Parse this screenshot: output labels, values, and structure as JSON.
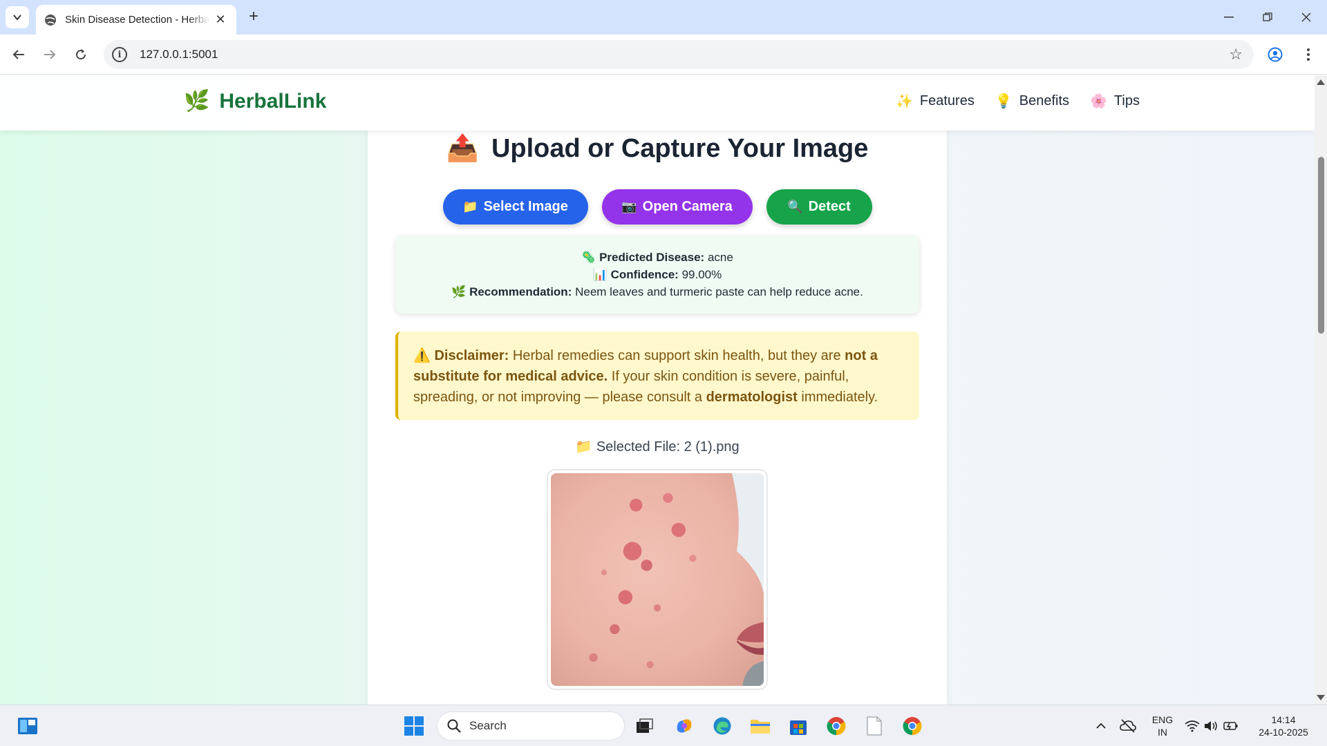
{
  "browser": {
    "tab_title": "Skin Disease Detection - HerbalLink",
    "url": "127.0.0.1:5001"
  },
  "site": {
    "logo": "HerbalLink",
    "nav": [
      {
        "icon": "✨",
        "label": "Features"
      },
      {
        "icon": "💡",
        "label": "Benefits"
      },
      {
        "icon": "🌸",
        "label": "Tips"
      }
    ]
  },
  "upload": {
    "title_icon": "📤",
    "title": "Upload or Capture Your Image",
    "buttons": [
      {
        "icon": "📁",
        "label": "Select Image",
        "color": "#2563eb"
      },
      {
        "icon": "📷",
        "label": "Open Camera",
        "color": "#9333ea"
      },
      {
        "icon": "🔍",
        "label": "Detect",
        "color": "#16a34a"
      }
    ]
  },
  "result": {
    "disease_icon": "🦠",
    "disease_label": "Predicted Disease:",
    "disease_value": "acne",
    "confidence_icon": "📊",
    "confidence_label": "Confidence:",
    "confidence_value": "99.00%",
    "recommendation_icon": "🌿",
    "recommendation_label": "Recommendation:",
    "recommendation_value": "Neem leaves and turmeric paste can help reduce acne."
  },
  "disclaimer": {
    "icon": "⚠️",
    "label": "Disclaimer:",
    "text1": "Herbal remedies can support skin health, but they are",
    "bold1": "not a substitute for medical advice.",
    "text2": "If your skin condition is severe, painful, spreading, or not improving — please consult a",
    "bold2": "dermatologist",
    "text3": "immediately."
  },
  "selected_file": {
    "icon": "📁",
    "label": "Selected File: 2 (1).png"
  },
  "taskbar": {
    "search_placeholder": "Search",
    "lang_top": "ENG",
    "lang_bottom": "IN",
    "time": "14:14",
    "date": "24-10-2025"
  }
}
